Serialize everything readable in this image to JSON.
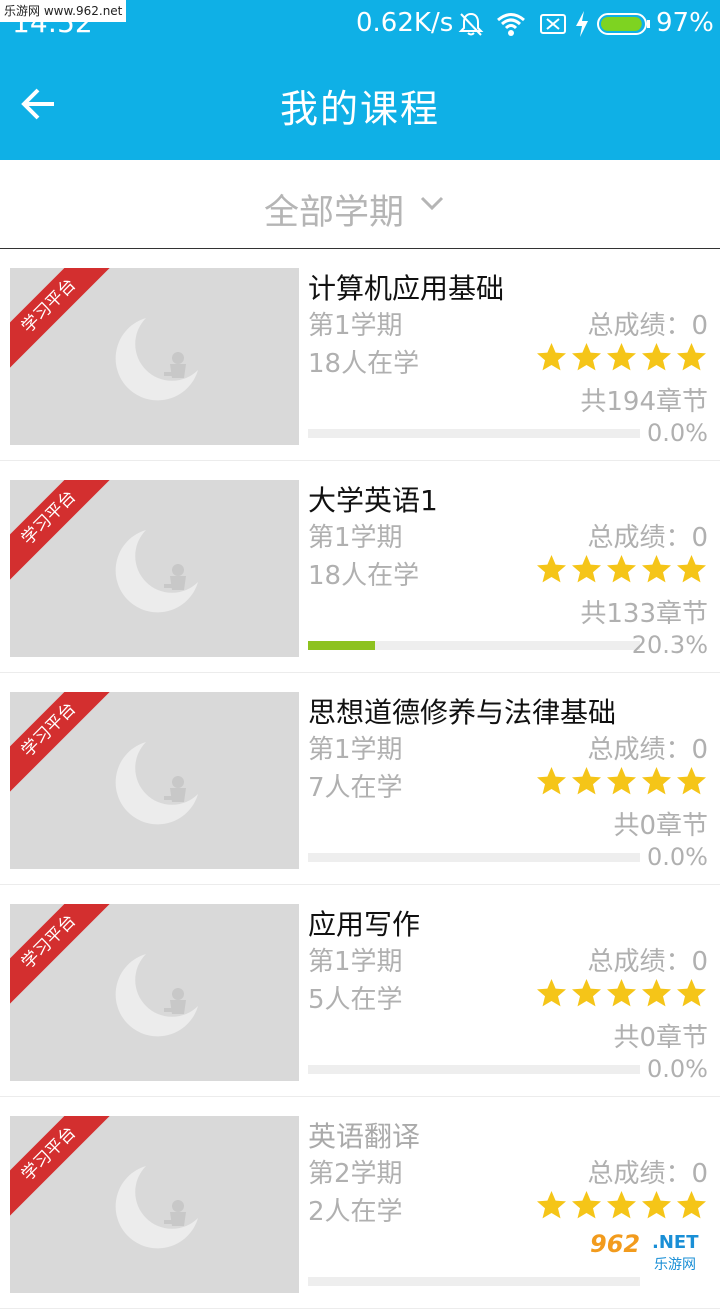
{
  "status_bar": {
    "site_tag": "乐游网 www.962.net",
    "time": "14:52",
    "net_speed": "0.62K/s",
    "battery": "97%",
    "icons": [
      "bell-off-icon",
      "wifi-icon",
      "sim-off-icon",
      "charging-icon",
      "battery-icon"
    ],
    "battery_level": 0.97
  },
  "app_bar": {
    "back_icon": "arrow-left-icon",
    "title": "我的课程"
  },
  "filter": {
    "label": "全部学期",
    "icon": "chevron-down-icon"
  },
  "ribbon_text": "学习平台",
  "courses": [
    {
      "title": "计算机应用基础",
      "term": "第1学期",
      "learners": "18人在学",
      "score": "总成绩：0",
      "stars": 5,
      "chapters": "共194章节",
      "progress_text": "0.0%",
      "progress": 0.0,
      "muted_title": false
    },
    {
      "title": "大学英语1",
      "term": "第1学期",
      "learners": "18人在学",
      "score": "总成绩：0",
      "stars": 5,
      "chapters": "共133章节",
      "progress_text": "20.3%",
      "progress": 0.203,
      "muted_title": false
    },
    {
      "title": "思想道德修养与法律基础",
      "term": "第1学期",
      "learners": "7人在学",
      "score": "总成绩：0",
      "stars": 5,
      "chapters": "共0章节",
      "progress_text": "0.0%",
      "progress": 0.0,
      "muted_title": false
    },
    {
      "title": "应用写作",
      "term": "第1学期",
      "learners": "5人在学",
      "score": "总成绩：0",
      "stars": 5,
      "chapters": "共0章节",
      "progress_text": "0.0%",
      "progress": 0.0,
      "muted_title": false
    },
    {
      "title": "英语翻译",
      "term": "第2学期",
      "learners": "2人在学",
      "score": "总成绩：0",
      "stars": 5,
      "chapters": "",
      "progress_text": "",
      "progress": 0.0,
      "muted_title": true
    }
  ],
  "colors": {
    "primary": "#0fb0e6",
    "ribbon": "#d32f2f",
    "star": "#f5c518",
    "progress_fill": "#8dc21f",
    "muted_text": "#b0b0b0"
  },
  "watermark": {
    "logo": "962",
    "net": ".NET",
    "sub": "乐游网"
  }
}
